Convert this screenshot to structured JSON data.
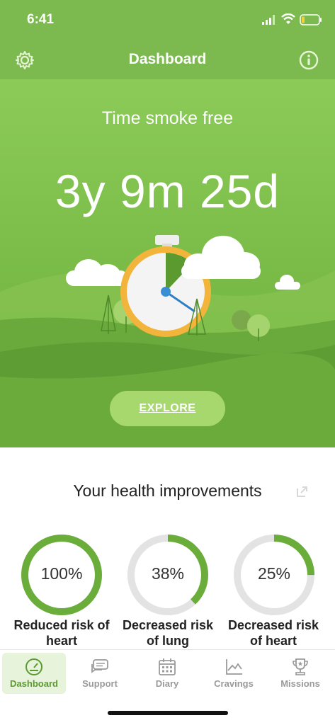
{
  "status_bar": {
    "time": "6:41"
  },
  "header": {
    "title": "Dashboard",
    "settings_icon": "gear-icon",
    "info_icon": "info-icon"
  },
  "hero": {
    "label": "Time smoke free",
    "duration": "3y 9m 25d",
    "explore_button": "EXPLORE",
    "stopwatch_progress": 0.12
  },
  "health": {
    "title": "Your health improvements",
    "expand_icon": "expand-icon",
    "items": [
      {
        "percent": "100%",
        "progress": 1.0,
        "label": "Reduced risk of heart"
      },
      {
        "percent": "38%",
        "progress": 0.38,
        "label": "Decreased risk of lung"
      },
      {
        "percent": "25%",
        "progress": 0.25,
        "label": "Decreased risk of heart"
      }
    ]
  },
  "tabs": [
    {
      "label": "Dashboard",
      "icon": "speedometer-icon",
      "active": true
    },
    {
      "label": "Support",
      "icon": "chat-icon",
      "active": false
    },
    {
      "label": "Diary",
      "icon": "calendar-icon",
      "active": false
    },
    {
      "label": "Cravings",
      "icon": "chart-icon",
      "active": false
    },
    {
      "label": "Missions",
      "icon": "trophy-icon",
      "active": false
    }
  ],
  "colors": {
    "accent": "#7cba4f",
    "ring_fill": "#6aad3a",
    "ring_track": "#e3e3e3",
    "tab_active": "#5a9a2e"
  }
}
